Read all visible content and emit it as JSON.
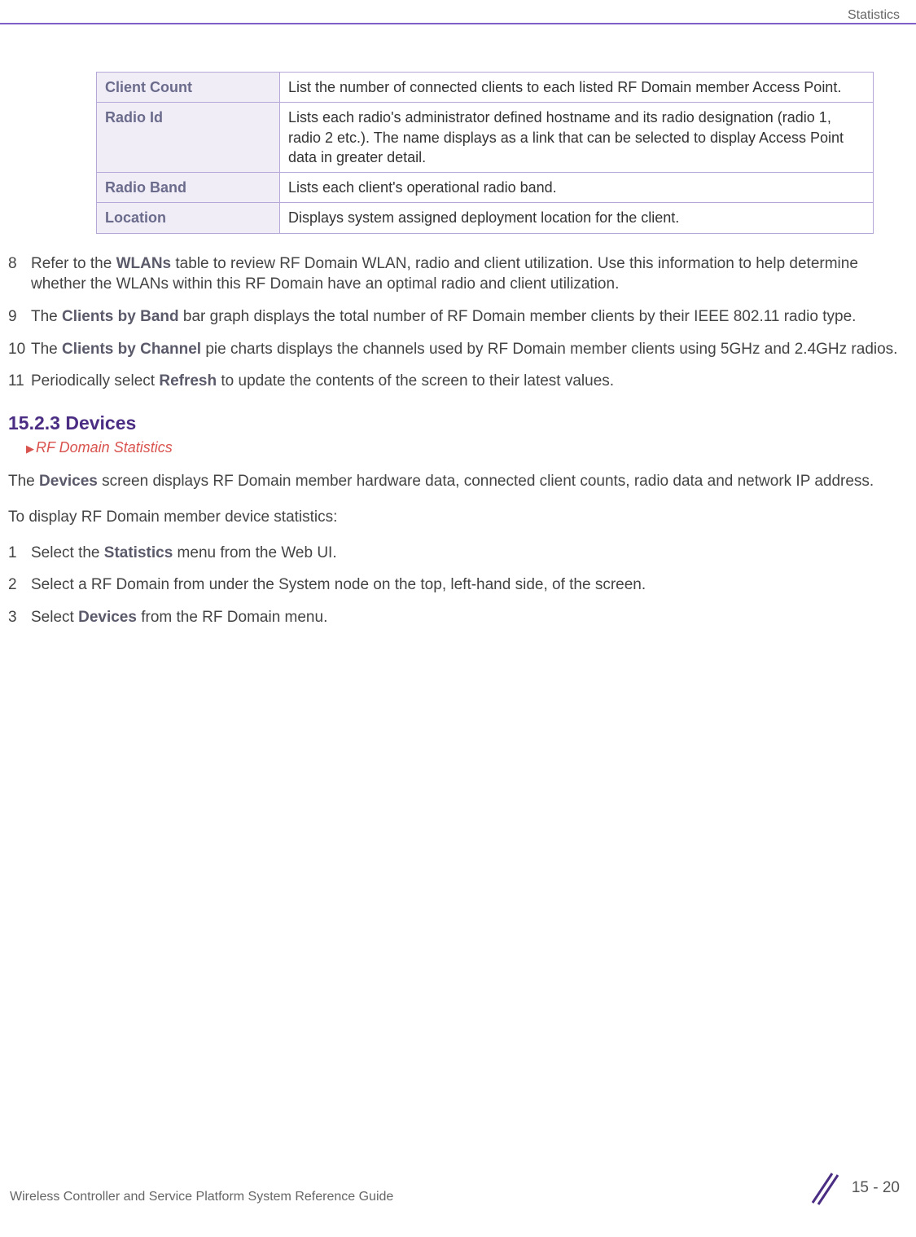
{
  "header": {
    "label": "Statistics"
  },
  "table": {
    "rows": [
      {
        "label": "Client Count",
        "desc": "List the number of connected clients to each listed RF Domain member Access Point."
      },
      {
        "label": "Radio Id",
        "desc": "Lists each radio's administrator defined hostname and its radio designation (radio 1, radio 2 etc.). The name displays as a link that can be selected to display Access Point data in greater detail."
      },
      {
        "label": "Radio Band",
        "desc": "Lists each client's operational radio band."
      },
      {
        "label": "Location",
        "desc": "Displays system assigned deployment location for the client."
      }
    ]
  },
  "steps_top": [
    {
      "num": "8",
      "pre": "Refer to the ",
      "bold": "WLANs",
      "post": " table to review RF Domain WLAN, radio and client utilization. Use this information to help determine whether the WLANs within this RF Domain have an optimal radio and client utilization."
    },
    {
      "num": "9",
      "pre": "The ",
      "bold": "Clients by Band",
      "post": " bar graph displays the total number of RF Domain member clients by their IEEE 802.11 radio type."
    },
    {
      "num": "10",
      "pre": "The ",
      "bold": "Clients by Channel",
      "post": " pie charts displays the channels used by RF Domain member clients using 5GHz and 2.4GHz radios."
    },
    {
      "num": "11",
      "pre": "Periodically select ",
      "bold": "Refresh",
      "post": " to update the contents of the screen to their latest values."
    }
  ],
  "section": {
    "heading": "15.2.3 Devices",
    "breadcrumb": "RF Domain Statistics",
    "intro_pre": "The ",
    "intro_bold": "Devices",
    "intro_post": " screen displays RF Domain member hardware data, connected client counts, radio data and network IP address.",
    "lead_in": "To display RF Domain member device statistics:"
  },
  "steps_bottom": [
    {
      "num": "1",
      "pre": "Select the ",
      "bold": "Statistics",
      "post": " menu from the Web UI."
    },
    {
      "num": "2",
      "pre": "Select a RF Domain from under the System node on the top, left-hand side, of the screen.",
      "bold": "",
      "post": ""
    },
    {
      "num": "3",
      "pre": "Select ",
      "bold": "Devices",
      "post": " from the RF Domain menu."
    }
  ],
  "footer": {
    "left": "Wireless Controller and Service Platform System Reference Guide",
    "page": "15 - 20"
  }
}
